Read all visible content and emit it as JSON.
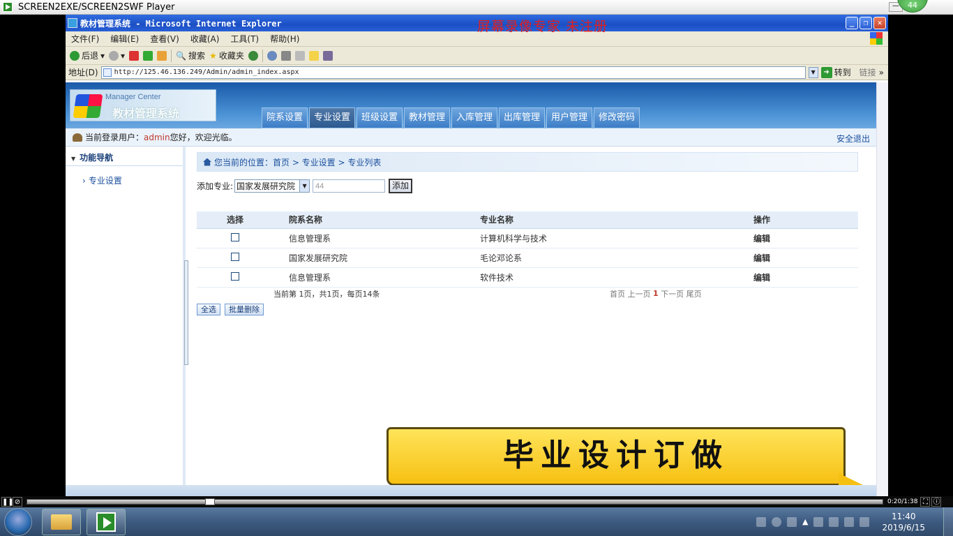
{
  "player": {
    "title": "SCREEN2EXE/SCREEN2SWF Player",
    "badge": "44",
    "time": "0:20/1:38",
    "progress": 0.21
  },
  "ie": {
    "title": "教材管理系统 - Microsoft Internet Explorer",
    "watermark": "屏幕录像专家  未注册",
    "menu": [
      "文件(F)",
      "编辑(E)",
      "查看(V)",
      "收藏(A)",
      "工具(T)",
      "帮助(H)"
    ],
    "toolbar": {
      "back": "后退",
      "search": "搜索",
      "favorites": "收藏夹"
    },
    "address_label": "地址(D)",
    "url": "http://125.46.136.249/Admin/admin_index.aspx",
    "go": "转到",
    "links": "链接"
  },
  "site": {
    "logo_en": "Manager Center",
    "logo_cn": "教材管理系统",
    "tabs": [
      "院系设置",
      "专业设置",
      "班级设置",
      "教材管理",
      "入库管理",
      "出库管理",
      "用户管理",
      "修改密码"
    ],
    "active_tab": 1,
    "user_prefix": "当前登录用户：",
    "user_name": "admin",
    "user_suffix": "您好，欢迎光临。",
    "logout": "安全退出",
    "sidebar_title": "功能导航",
    "sidebar_item": "专业设置",
    "breadcrumb": "您当前的位置：首页 > 专业设置 > 专业列表",
    "add_label": "添加专业:",
    "add_select": "国家发展研究院",
    "add_input": "44",
    "add_button": "添加",
    "columns": [
      "选择",
      "院系名称",
      "专业名称",
      "操作"
    ],
    "rows": [
      {
        "dept": "信息管理系",
        "major": "计算机科学与技术",
        "action": "编辑"
      },
      {
        "dept": "国家发展研究院",
        "major": "毛论邓论系",
        "action": "编辑"
      },
      {
        "dept": "信息管理系",
        "major": "软件技术",
        "action": "编辑"
      }
    ],
    "pager_info": "当前第  1页，共1页，每页14条",
    "pager": {
      "first": "首页",
      "prev": "上一页",
      "current": "1",
      "next": "下一页",
      "last": "尾页"
    },
    "select_all": "全选",
    "bulk_delete": "批量删除"
  },
  "ad_text": "毕业设计订做",
  "taskbar": {
    "time": "11:40",
    "date": "2019/6/15"
  }
}
